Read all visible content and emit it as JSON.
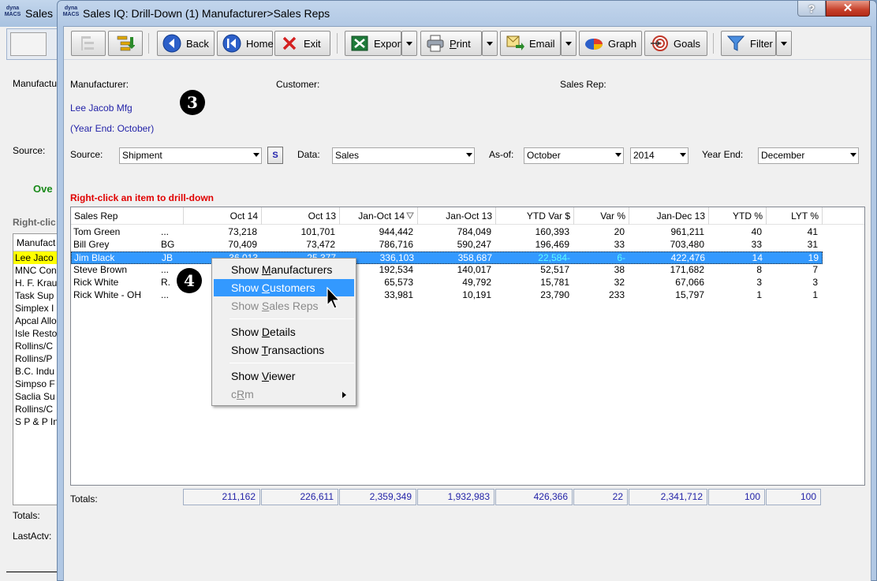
{
  "bg_window": {
    "title": "Sales",
    "labels": [
      "Manufactu",
      "Source:",
      "Totals:",
      "LastActv:"
    ],
    "overview_tab": "Ove",
    "right_click_hint": "Right-clic",
    "list_header": "Manufact",
    "list_items": [
      "Lee Jaco",
      "MNC Con",
      "H. F. Krau",
      "Task Sup",
      "Simplex I",
      "Apcal Allo",
      "Isle Resto",
      "Rollins/C",
      "Rollins/P",
      "B.C. Indu",
      "Simpso F",
      "Saclia Su",
      "Rollins/C",
      "S P & P In"
    ]
  },
  "window": {
    "logo": "dyna MACS",
    "title": "Sales IQ: Drill-Down (1) Manufacturer>Sales Reps",
    "help_label": "?",
    "close_label": "✕"
  },
  "toolbar": {
    "back": "Back",
    "home": "Home",
    "exit": "Exit",
    "export": "Export",
    "print": "Print",
    "email": "Email",
    "graph": "Graph",
    "goals": "Goals",
    "filter": "Filter"
  },
  "header": {
    "manufacturer_label": "Manufacturer:",
    "customer_label": "Customer:",
    "salesrep_label": "Sales Rep:",
    "manufacturer_value": "Lee Jacob Mfg",
    "year_end_note": "(Year End: October)",
    "step_3": "3",
    "step_4": "4"
  },
  "filters": {
    "source_label": "Source:",
    "source_value": "Shipment",
    "s_button": "S",
    "data_label": "Data:",
    "data_value": "Sales",
    "asof_label": "As-of:",
    "asof_month": "October",
    "asof_year": "2014",
    "yearend_label": "Year End:",
    "yearend_value": "December"
  },
  "hint": "Right-click an item to drill-down",
  "table": {
    "columns": [
      "Sales Rep",
      "Oct 14",
      "Oct 13",
      "Jan-Oct 14",
      "Jan-Oct 13",
      "YTD Var $",
      "Var %",
      "Jan-Dec 13",
      "YTD %",
      "LYT %"
    ],
    "rows": [
      {
        "name": "Tom Green",
        "code": "...",
        "c1": "73,218",
        "c2": "101,701",
        "c3": "944,442",
        "c4": "784,049",
        "c5": "160,393",
        "c6": "20",
        "c7": "961,211",
        "c8": "40",
        "c9": "41"
      },
      {
        "name": "Bill Grey",
        "code": "BG",
        "c1": "70,409",
        "c2": "73,472",
        "c3": "786,716",
        "c4": "590,247",
        "c5": "196,469",
        "c6": "33",
        "c7": "703,480",
        "c8": "33",
        "c9": "31"
      },
      {
        "name": "Jim Black",
        "code": "JB",
        "c1": "36,013",
        "c2": "25,377",
        "c3": "336,103",
        "c4": "358,687",
        "c5": "22,584-",
        "c6": "6-",
        "c7": "422,476",
        "c8": "14",
        "c9": "19"
      },
      {
        "name": "Steve Brown",
        "code": "...",
        "c1": "",
        "c2": "",
        "c3": "192,534",
        "c4": "140,017",
        "c5": "52,517",
        "c6": "38",
        "c7": "171,682",
        "c8": "8",
        "c9": "7"
      },
      {
        "name": "Rick White",
        "code": "R.",
        "c1": "",
        "c2": "",
        "c3": "65,573",
        "c4": "49,792",
        "c5": "15,781",
        "c6": "32",
        "c7": "67,066",
        "c8": "3",
        "c9": "3"
      },
      {
        "name": "Rick White - OH",
        "code": "...",
        "c1": "",
        "c2": "",
        "c3": "33,981",
        "c4": "10,191",
        "c5": "23,790",
        "c6": "233",
        "c7": "15,797",
        "c8": "1",
        "c9": "1"
      }
    ],
    "totals_label": "Totals:",
    "totals": [
      "211,162",
      "226,611",
      "2,359,349",
      "1,932,983",
      "426,366",
      "22",
      "2,341,712",
      "100",
      "100"
    ]
  },
  "context_menu": {
    "items": [
      {
        "label": "Show Manufacturers",
        "state": "normal"
      },
      {
        "label": "Show Customers",
        "state": "hover"
      },
      {
        "label": "Show Sales Reps",
        "state": "disabled"
      },
      {
        "label": "Show Details",
        "state": "normal"
      },
      {
        "label": "Show Transactions",
        "state": "normal"
      },
      {
        "label": "Show Viewer",
        "state": "normal"
      },
      {
        "label": "cRm",
        "state": "disabled"
      }
    ]
  },
  "colors": {
    "selection": "#3399ff",
    "hint_red": "#e00000",
    "value_blue": "#2323a8",
    "negative_cyan": "#5dfcff"
  }
}
